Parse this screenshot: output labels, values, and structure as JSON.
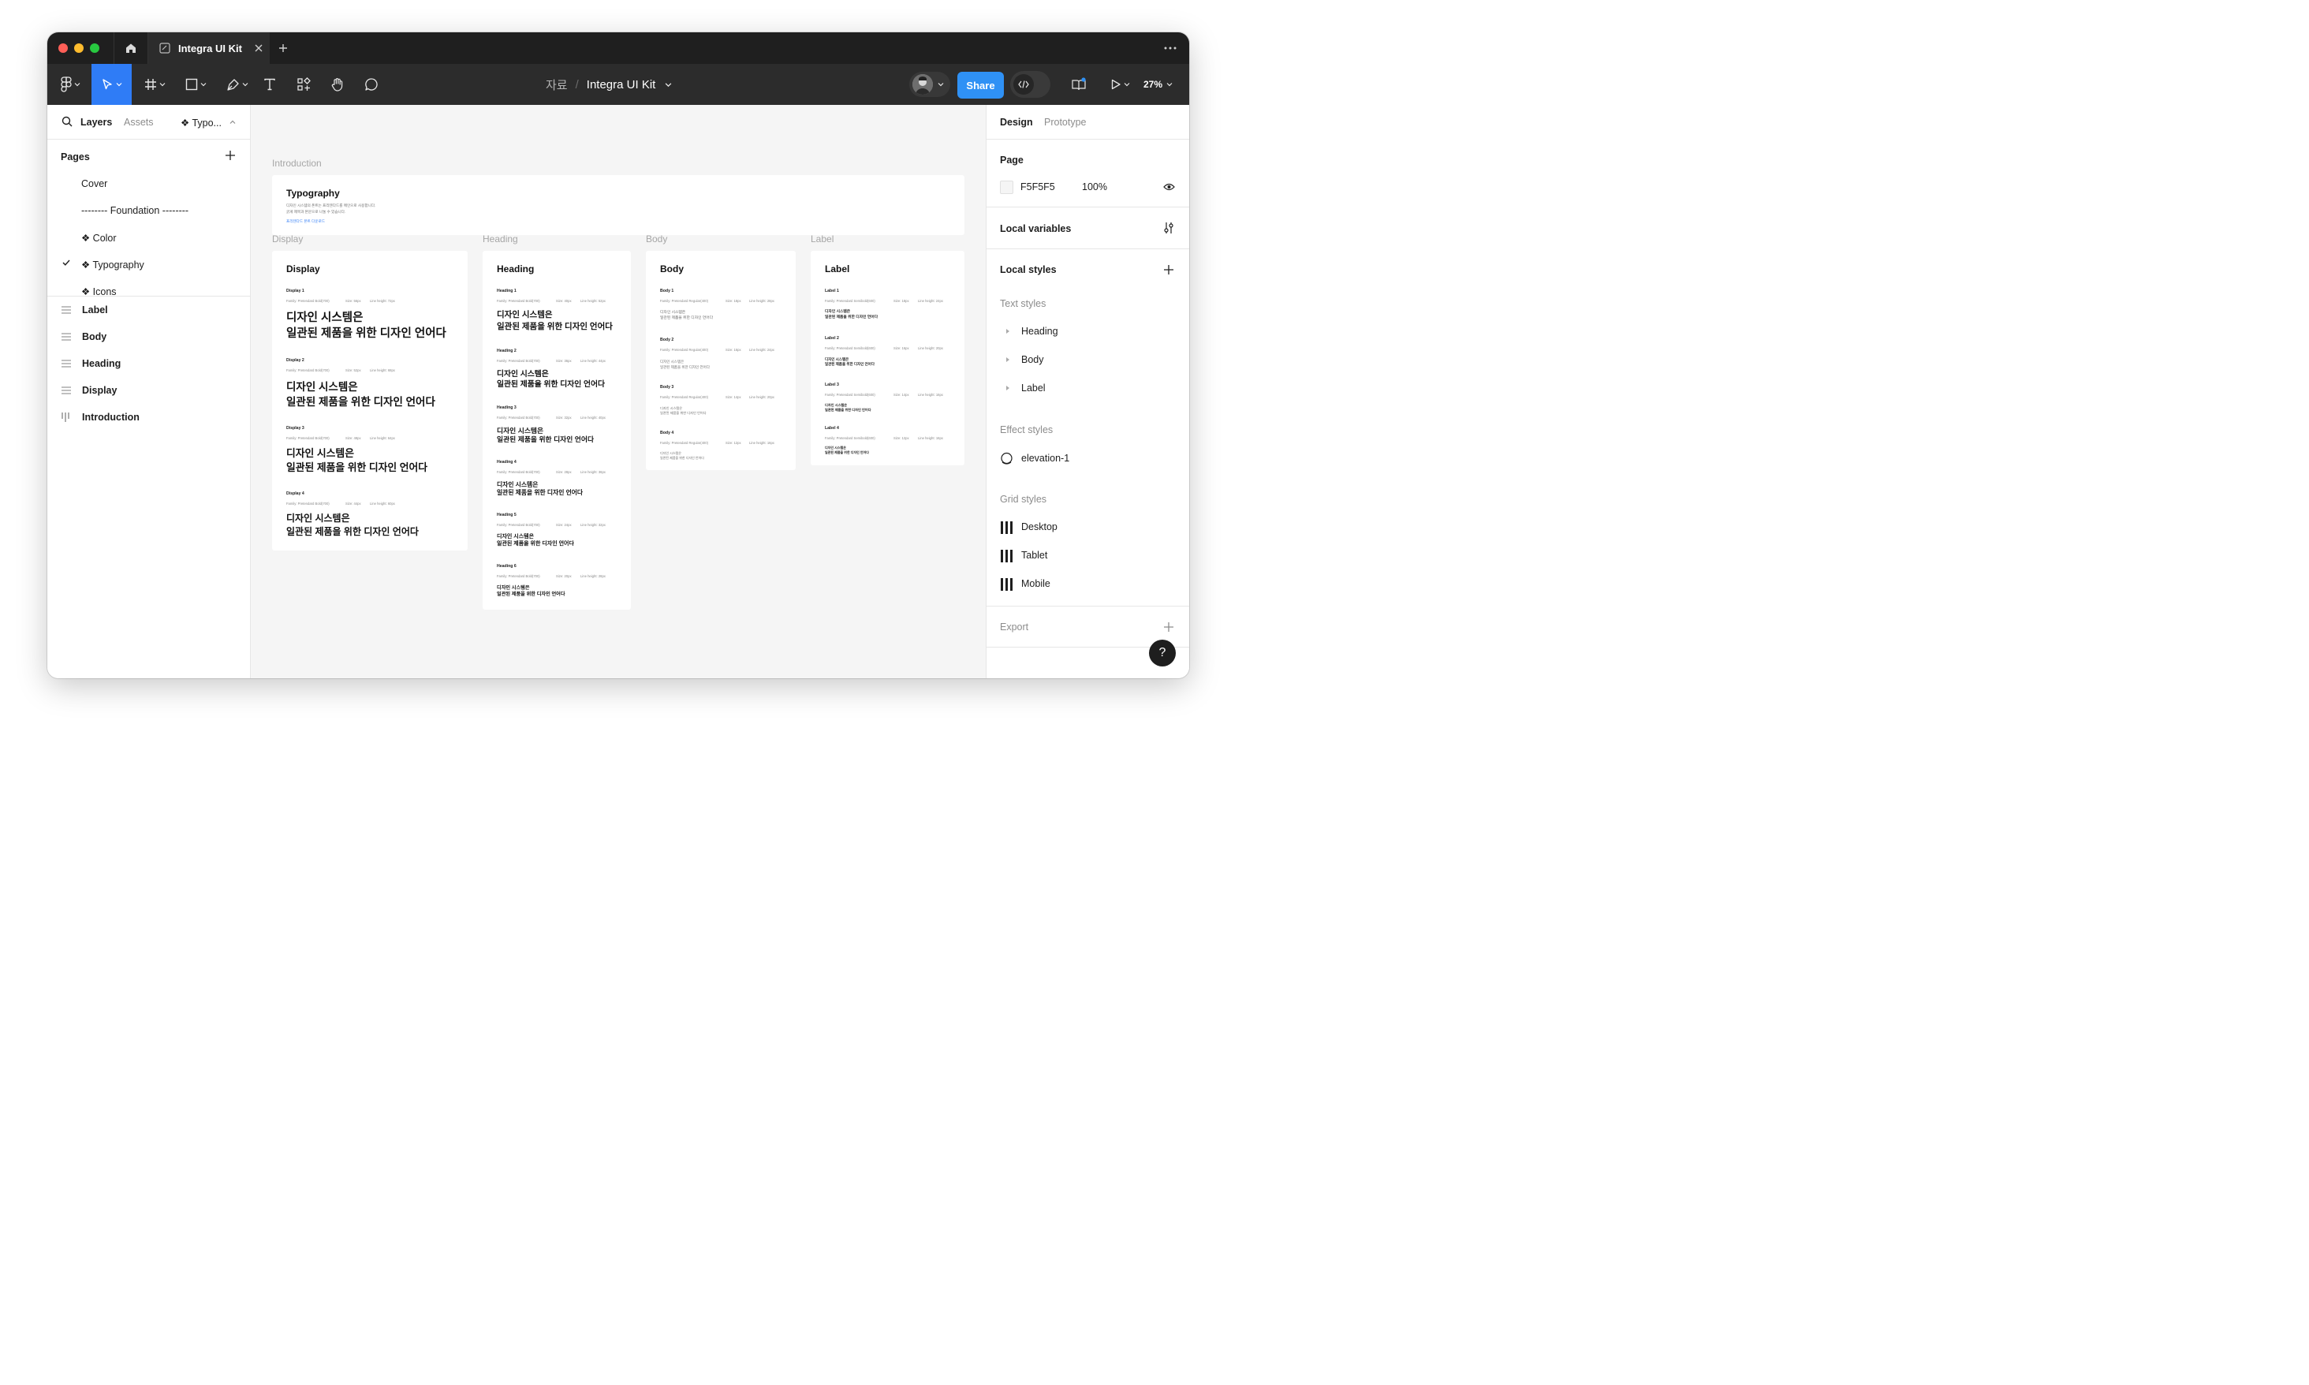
{
  "tabbar": {
    "file_tab_label": "Integra UI Kit",
    "traffic_colors": [
      "#ff5f57",
      "#febc2e",
      "#28c840"
    ]
  },
  "toolbar": {
    "breadcrumb_project": "자료",
    "breadcrumb_separator": "/",
    "breadcrumb_file": "Integra UI Kit",
    "share_label": "Share",
    "zoom": "27%",
    "accent": "#2f7cf6",
    "share_color": "#2f91f5"
  },
  "left": {
    "tabs": {
      "layers": "Layers",
      "assets": "Assets",
      "page_picker": "❖ Typo..."
    },
    "pages_title": "Pages",
    "pages": [
      "Cover",
      "-------- Foundation --------",
      "❖ Color",
      "❖ Typography",
      "❖ Icons"
    ],
    "current_page": "❖ Typography",
    "layers": [
      "Label",
      "Body",
      "Heading",
      "Display",
      "Introduction"
    ]
  },
  "canvas": {
    "frame_labels": {
      "introduction": "Introduction",
      "display": "Display",
      "heading": "Heading",
      "body": "Body",
      "label": "Label"
    },
    "intro": {
      "title": "Typography",
      "desc_line1": "디자인 시스템의 폰트는 프리텐다드를 메인으로 사용합니다.",
      "desc_line2": "굵게 제목과 본문으로 나눌 수 있습니다.",
      "link": "프리텐다드 폰트 다운로드"
    },
    "sample_line1": "디자인 시스템은",
    "sample_line2": "일관된 제품을 위한 디자인 언어다",
    "display": {
      "title": "Display",
      "items": [
        {
          "name": "Display 1",
          "family": "Family: Pretendard Bold(700)",
          "size": "Size: 56px",
          "lh": "Line height: 72px"
        },
        {
          "name": "Display 2",
          "family": "Family: Pretendard Bold(700)",
          "size": "Size: 52px",
          "lh": "Line height: 68px"
        },
        {
          "name": "Display 3",
          "family": "Family: Pretendard Bold(700)",
          "size": "Size: 48px",
          "lh": "Line height: 64px"
        },
        {
          "name": "Display 4",
          "family": "Family: Pretendard Bold(700)",
          "size": "Size: 44px",
          "lh": "Line height: 60px"
        }
      ]
    },
    "heading": {
      "title": "Heading",
      "items": [
        {
          "name": "Heading 1",
          "family": "Family: Pretendard Bold(700)",
          "size": "Size: 40px",
          "lh": "Line height: 52px"
        },
        {
          "name": "Heading 2",
          "family": "Family: Pretendard Bold(700)",
          "size": "Size: 36px",
          "lh": "Line height: 44px"
        },
        {
          "name": "Heading 3",
          "family": "Family: Pretendard Bold(700)",
          "size": "Size: 32px",
          "lh": "Line height: 40px"
        },
        {
          "name": "Heading 4",
          "family": "Family: Pretendard Bold(700)",
          "size": "Size: 28px",
          "lh": "Line height: 36px"
        },
        {
          "name": "Heading 5",
          "family": "Family: Pretendard Bold(700)",
          "size": "Size: 24px",
          "lh": "Line height: 32px"
        },
        {
          "name": "Heading 6",
          "family": "Family: Pretendard Bold(700)",
          "size": "Size: 20px",
          "lh": "Line height: 28px"
        }
      ]
    },
    "body": {
      "title": "Body",
      "items": [
        {
          "name": "Body 1",
          "family": "Family: Pretendard Regular(400)",
          "size": "Size: 18px",
          "lh": "Line height: 28px"
        },
        {
          "name": "Body 2",
          "family": "Family: Pretendard Regular(400)",
          "size": "Size: 16px",
          "lh": "Line height: 24px"
        },
        {
          "name": "Body 3",
          "family": "Family: Pretendard Regular(400)",
          "size": "Size: 14px",
          "lh": "Line height: 20px"
        },
        {
          "name": "Body 4",
          "family": "Family: Pretendard Regular(400)",
          "size": "Size: 12px",
          "lh": "Line height: 16px"
        }
      ]
    },
    "label": {
      "title": "Label",
      "items": [
        {
          "name": "Label 1",
          "family": "Family: Pretendard Semibold(600)",
          "size": "Size: 18px",
          "lh": "Line height: 24px"
        },
        {
          "name": "Label 2",
          "family": "Family: Pretendard Semibold(600)",
          "size": "Size: 16px",
          "lh": "Line height: 20px"
        },
        {
          "name": "Label 3",
          "family": "Family: Pretendard Semibold(600)",
          "size": "Size: 14px",
          "lh": "Line height: 16px"
        },
        {
          "name": "Label 4",
          "family": "Family: Pretendard Semibold(600)",
          "size": "Size: 12px",
          "lh": "Line height: 16px"
        }
      ]
    }
  },
  "right": {
    "tabs": {
      "design": "Design",
      "prototype": "Prototype"
    },
    "page": {
      "title": "Page",
      "color_hex": "F5F5F5",
      "opacity": "100%",
      "swatch": "#f5f5f5"
    },
    "local_variables": "Local variables",
    "local_styles": "Local styles",
    "text_styles": {
      "title": "Text styles",
      "items": [
        "Heading",
        "Body",
        "Label"
      ]
    },
    "effect_styles": {
      "title": "Effect styles",
      "items": [
        "elevation-1"
      ]
    },
    "grid_styles": {
      "title": "Grid styles",
      "items": [
        "Desktop",
        "Tablet",
        "Mobile"
      ]
    },
    "export": "Export",
    "help": "?"
  }
}
